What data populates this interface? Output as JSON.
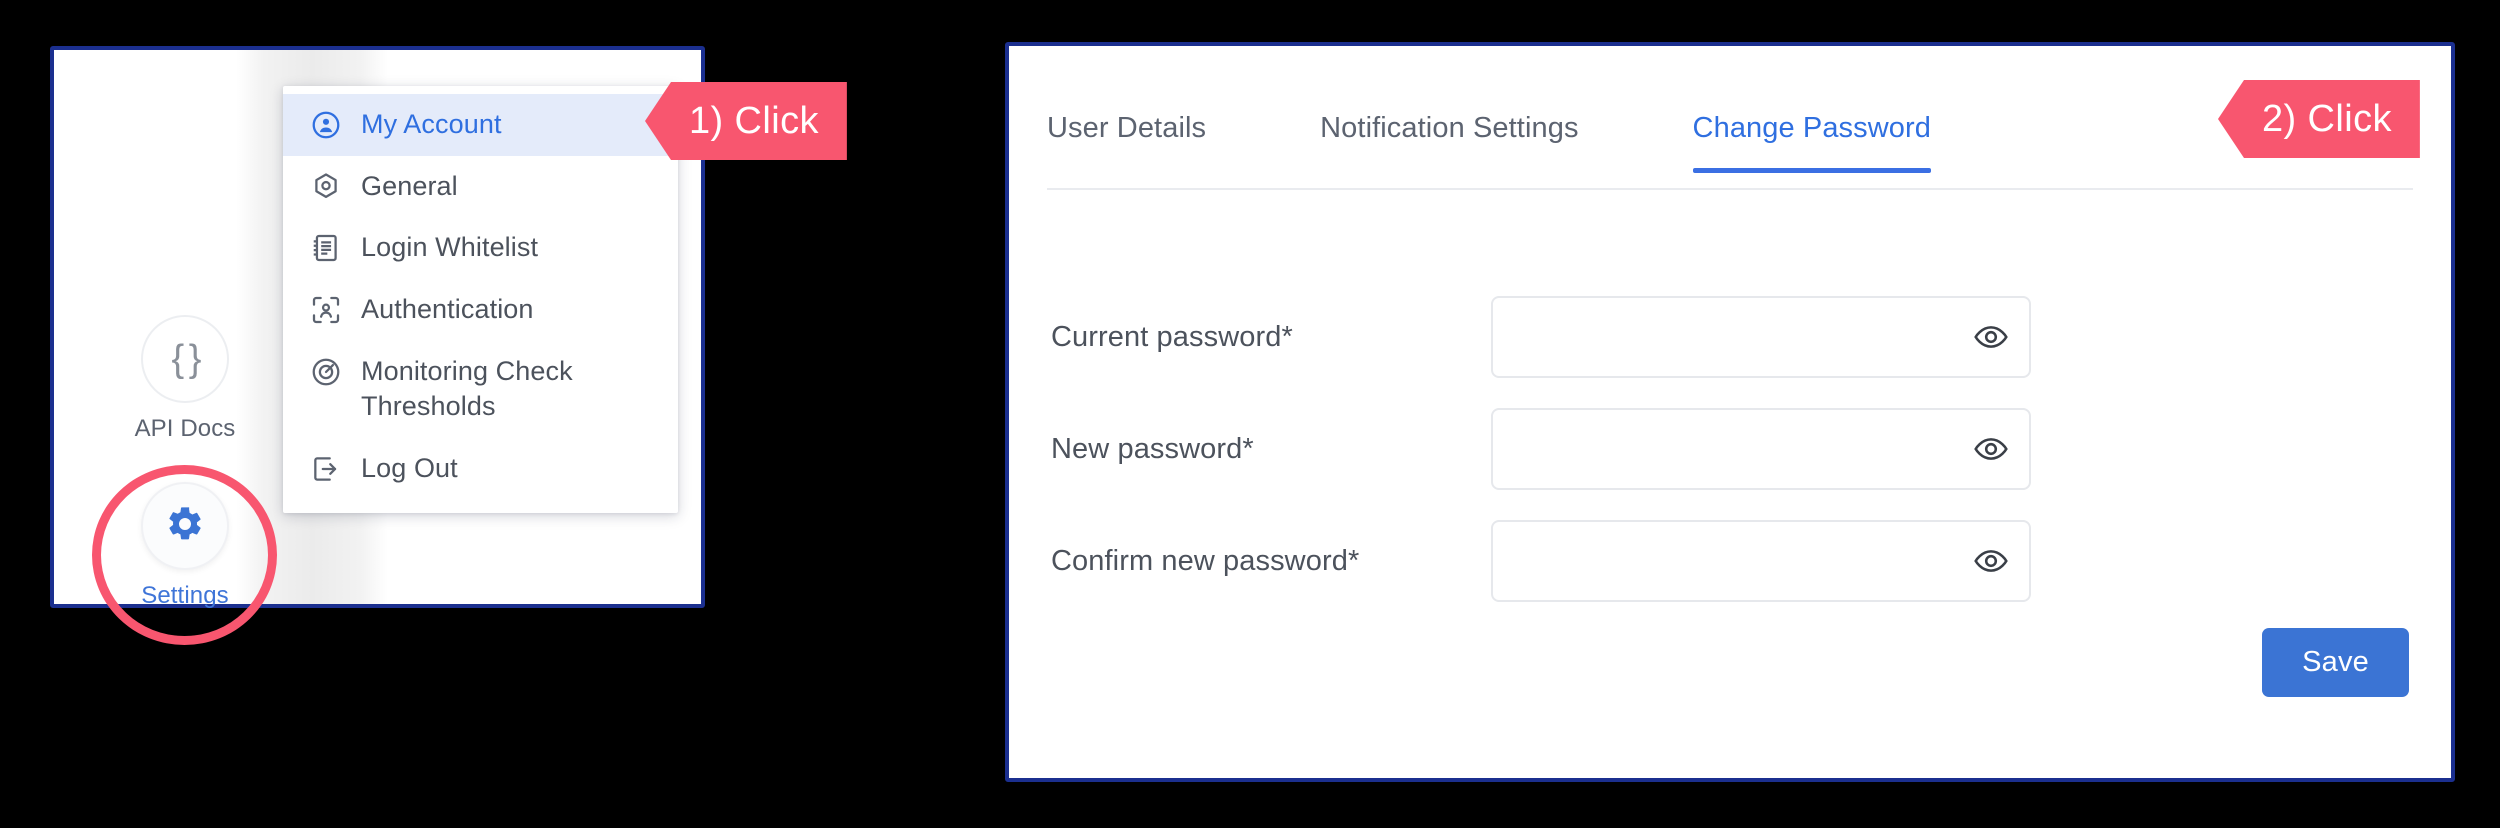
{
  "left_panel": {
    "rail": [
      {
        "id": "api-docs",
        "label": "API Docs",
        "icon": "code-braces-icon",
        "glyph": "{ }"
      },
      {
        "id": "settings",
        "label": "Settings",
        "icon": "gear-icon"
      }
    ],
    "menu": {
      "items": [
        {
          "label": "My Account",
          "icon": "account-circle-icon",
          "active": true
        },
        {
          "label": "General",
          "icon": "hexagon-settings-icon",
          "active": false
        },
        {
          "label": "Login Whitelist",
          "icon": "notebook-list-icon",
          "active": false
        },
        {
          "label": "Authentication",
          "icon": "face-scan-icon",
          "active": false
        },
        {
          "label": "Monitoring Check Thresholds",
          "icon": "target-radar-icon",
          "active": false
        },
        {
          "label": "Log Out",
          "icon": "logout-arrow-icon",
          "active": false
        }
      ]
    }
  },
  "right_panel": {
    "tabs": [
      {
        "label": "User Details",
        "active": false
      },
      {
        "label": "Notification Settings",
        "active": false
      },
      {
        "label": "Change Password",
        "active": true
      }
    ],
    "form": {
      "fields": [
        {
          "label": "Current password*",
          "value": "",
          "placeholder": "",
          "toggle_icon": "eye-icon"
        },
        {
          "label": "New password*",
          "value": "",
          "placeholder": "",
          "toggle_icon": "eye-icon"
        },
        {
          "label": "Confirm new password*",
          "value": "",
          "placeholder": "",
          "toggle_icon": "eye-icon"
        }
      ],
      "save_label": "Save"
    }
  },
  "annotations": {
    "callout_1": "1) Click",
    "callout_2": "2) Click"
  },
  "colors": {
    "panel_border": "#1b2f8f",
    "accent_blue": "#2f6fe0",
    "save_blue": "#3b74d4",
    "callout_red": "#f8566f",
    "menu_active_bg": "#e4ebfa",
    "text_gray": "#4c525c"
  }
}
